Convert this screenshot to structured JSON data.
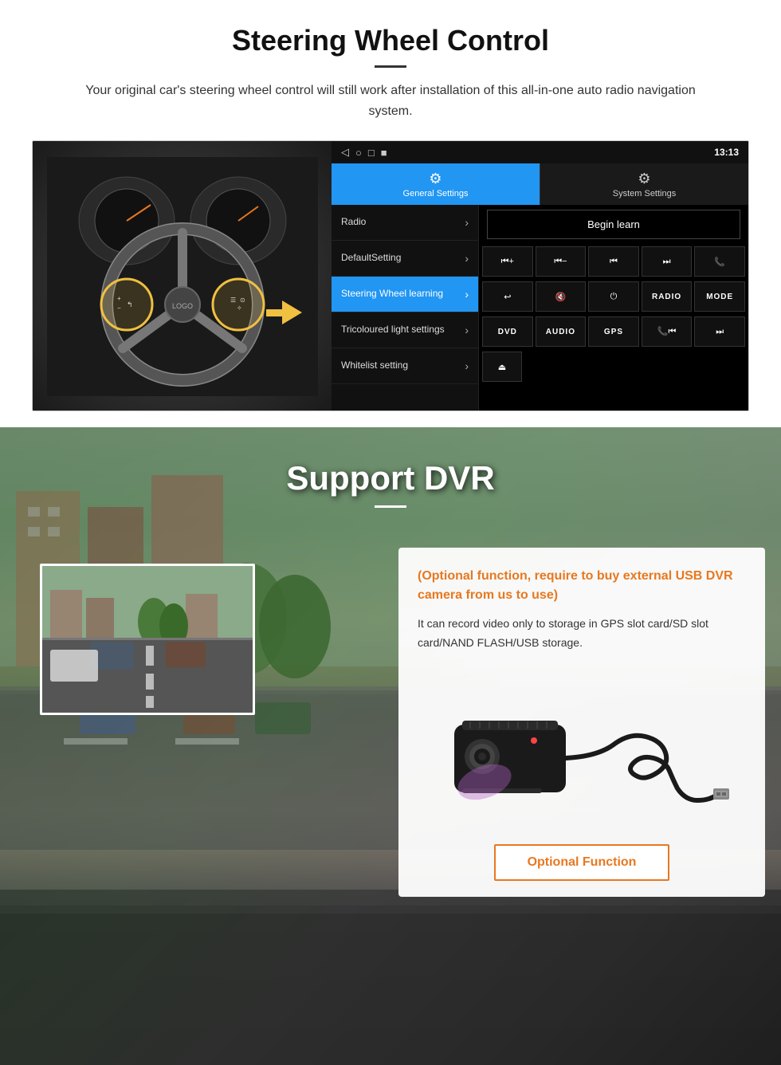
{
  "page": {
    "section1": {
      "title": "Steering Wheel Control",
      "subtitle": "Your original car's steering wheel control will still work after installation of this all-in-one auto radio navigation system.",
      "android_ui": {
        "statusbar": {
          "time": "13:13",
          "icons": [
            "◁",
            "○",
            "□",
            "■"
          ]
        },
        "tabs": [
          {
            "label": "General Settings",
            "icon": "⚙",
            "active": true
          },
          {
            "label": "System Settings",
            "icon": "⚙",
            "active": false
          }
        ],
        "menu_items": [
          {
            "label": "Radio",
            "active": false
          },
          {
            "label": "DefaultSetting",
            "active": false
          },
          {
            "label": "Steering Wheel learning",
            "active": true
          },
          {
            "label": "Tricoloured light settings",
            "active": false
          },
          {
            "label": "Whitelist setting",
            "active": false
          }
        ],
        "begin_learn_btn": "Begin learn",
        "control_buttons": [
          "⏮+",
          "⏮−",
          "⏮",
          "⏭",
          "📞",
          "↩",
          "🔇",
          "⏻",
          "RADIO",
          "MODE",
          "DVD",
          "AUDIO",
          "GPS",
          "📞⏮",
          "⏭"
        ],
        "bottom_row": [
          "⏏"
        ]
      }
    },
    "section2": {
      "title": "Support DVR",
      "optional_label": "(Optional function, require to buy external USB DVR camera from us to use)",
      "description": "It can record video only to storage in GPS slot card/SD slot card/NAND FLASH/USB storage.",
      "optional_function_btn": "Optional Function"
    }
  }
}
